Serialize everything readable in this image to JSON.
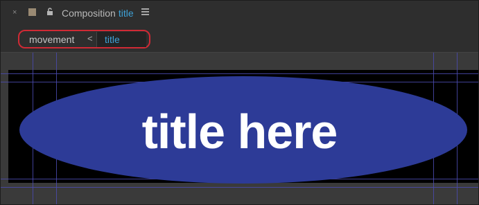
{
  "tab": {
    "close_glyph": "×",
    "lock_glyph": "🔓",
    "label": "Composition",
    "comp_name": "title"
  },
  "breadcrumbs": [
    {
      "label": "movement"
    },
    {
      "label": "title"
    }
  ],
  "breadcrumb_separator": "<",
  "viewer": {
    "text_layer": "title here"
  },
  "colors": {
    "accent": "#3ea2d8",
    "highlight_outline": "#d02a35",
    "ellipse_fill": "#2d3b97",
    "guide": "#4b4bb0"
  }
}
